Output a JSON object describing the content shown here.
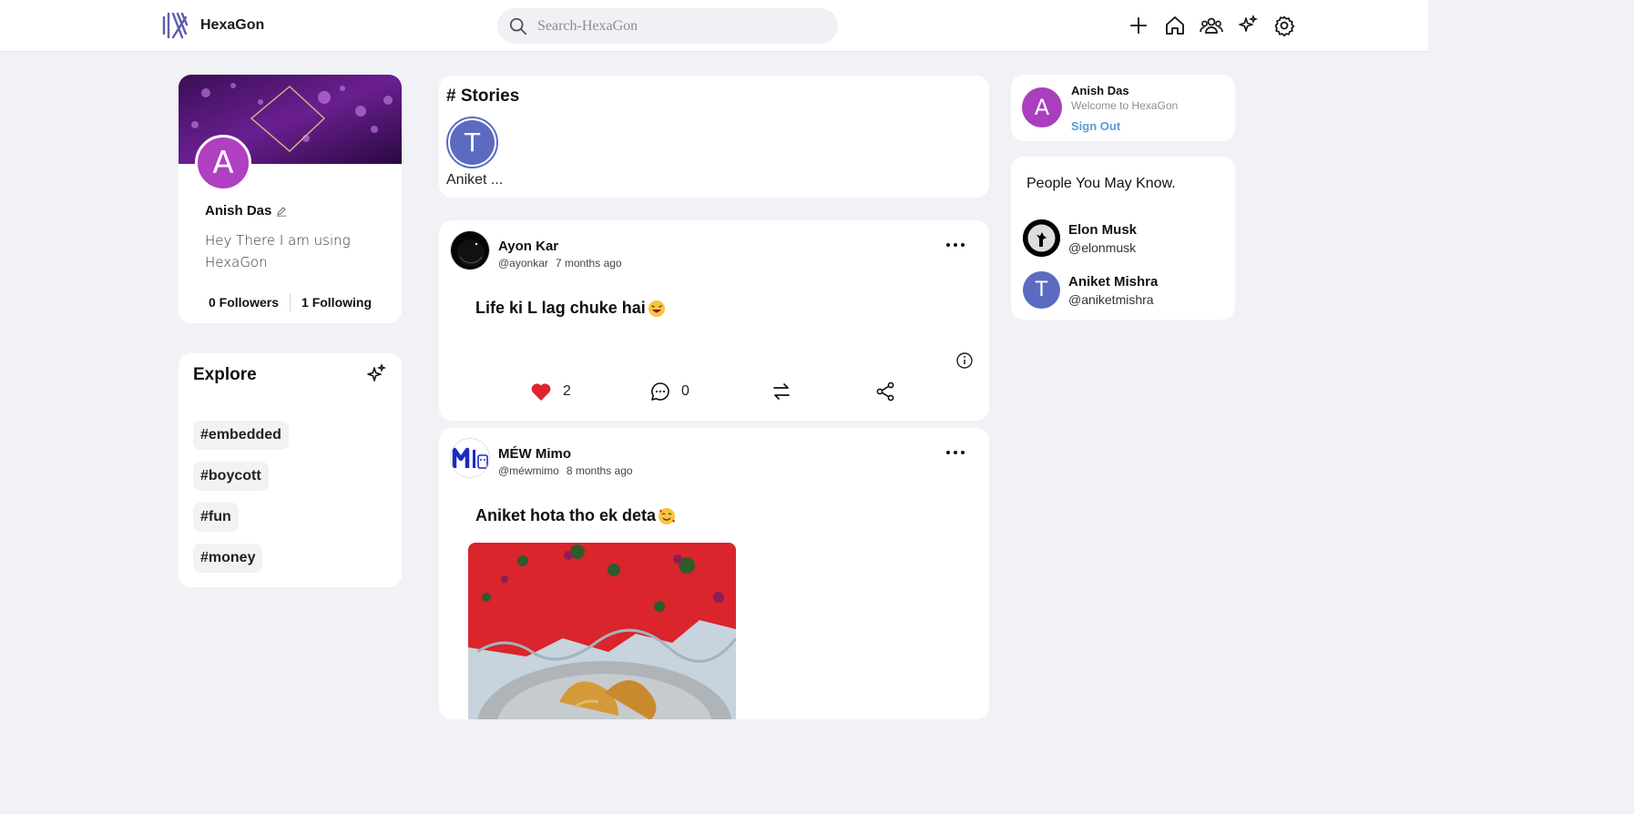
{
  "app": {
    "name": "HexaGon"
  },
  "search": {
    "placeholder": "Search-HexaGon"
  },
  "nav_icons": [
    "plus-icon",
    "home-icon",
    "friends-icon",
    "sparkles-icon",
    "settings-icon"
  ],
  "profile": {
    "initial": "A",
    "name": "Anish Das",
    "bio": "Hey There I am using HexaGon",
    "followers": "0 Followers",
    "following": "1 Following"
  },
  "explore": {
    "title": "Explore",
    "tags": [
      "#embedded",
      "#boycott",
      "#fun",
      "#money"
    ]
  },
  "stories": {
    "title": "# Stories",
    "items": [
      {
        "initial": "T",
        "name": "Aniket ..."
      }
    ]
  },
  "posts": [
    {
      "author": "Ayon Kar",
      "handle": "@ayonkar",
      "time": "7 months ago",
      "text": "Life ki L lag chuke hai",
      "likes": "2",
      "comments": "0"
    },
    {
      "author": "MÉW Mimo",
      "handle": "@méwmimo",
      "time": "8 months ago",
      "text": "Aniket hota tho ek deta"
    }
  ],
  "me": {
    "initial": "A",
    "name": "Anish Das",
    "welcome": "Welcome to HexaGon",
    "signout": "Sign Out"
  },
  "people": {
    "title": "People You May Know.",
    "items": [
      {
        "name": "Elon Musk",
        "handle": "@elonmusk"
      },
      {
        "name": "Aniket Mishra",
        "handle": "@aniketmishra",
        "initial": "T"
      }
    ]
  },
  "colors": {
    "accent_purple": "#b03fc2",
    "story_blue": "#5c6bc0",
    "link_blue": "#5a9bd5",
    "like_red": "#e0242f"
  }
}
